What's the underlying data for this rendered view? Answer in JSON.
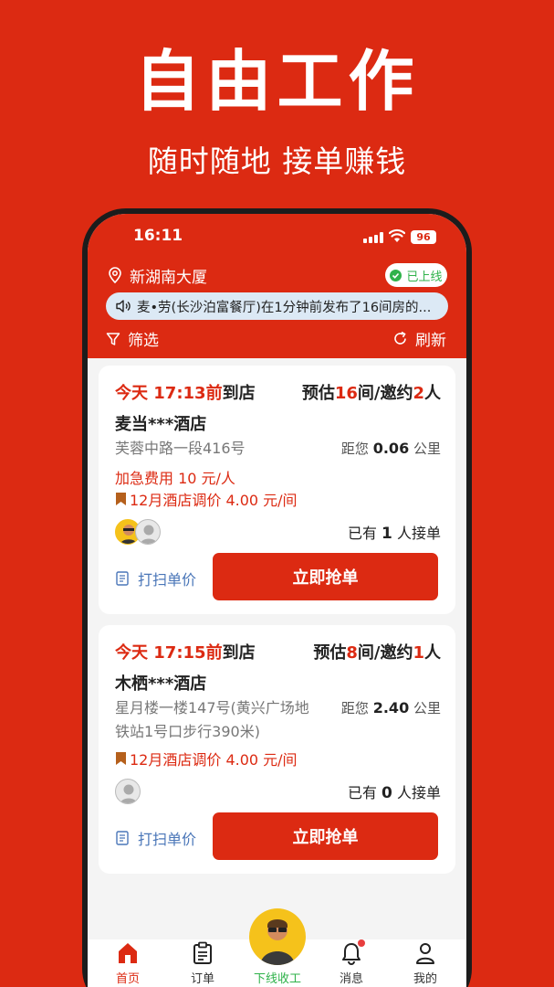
{
  "hero": {
    "title": "自由工作",
    "subtitle": "随时随地 接单赚钱"
  },
  "status_bar": {
    "time": "16:11",
    "battery": "96"
  },
  "header": {
    "location": "新湖南大厦",
    "online_status": "已上线",
    "notice": "麦•劳(长沙泊富餐厅)在1分钟前发布了16间房的...",
    "filter_label": "筛选",
    "refresh_label": "刷新"
  },
  "orders": [
    {
      "day": "今天",
      "time": "17:13前",
      "arrive": "到店",
      "est_prefix": "预估",
      "rooms": "16",
      "rooms_unit": "间/邀约",
      "people": "2",
      "people_unit": "人",
      "hotel": "麦当***酒店",
      "address": "芙蓉中路一段416号",
      "distance_prefix": "距您",
      "distance": "0.06",
      "distance_unit": "公里",
      "rush_fee": "加急费用 10 元/人",
      "price_adjust": "12月酒店调价 4.00 元/间",
      "taken_prefix": "已有",
      "taken_count": "1",
      "taken_suffix": "人接单",
      "scan_label": "打扫单价",
      "grab_label": "立即抢单"
    },
    {
      "day": "今天",
      "time": "17:15前",
      "arrive": "到店",
      "est_prefix": "预估",
      "rooms": "8",
      "rooms_unit": "间/邀约",
      "people": "1",
      "people_unit": "人",
      "hotel": "木栖***酒店",
      "address_line1": "星月楼一楼147号(黄兴广场地",
      "address_line2": "铁站1号口步行390米)",
      "distance_prefix": "距您",
      "distance": "2.40",
      "distance_unit": "公里",
      "price_adjust": "12月酒店调价 4.00 元/间",
      "taken_prefix": "已有",
      "taken_count": "0",
      "taken_suffix": "人接单",
      "scan_label": "打扫单价",
      "grab_label": "立即抢单"
    }
  ],
  "tabbar": {
    "home": "首页",
    "orders": "订单",
    "offline": "下线收工",
    "messages": "消息",
    "mine": "我的"
  },
  "colors": {
    "brand_red": "#dc2a12",
    "online_green": "#2fb24a",
    "link_blue": "#4a76b8",
    "avatar_yellow": "#f5c21b"
  }
}
